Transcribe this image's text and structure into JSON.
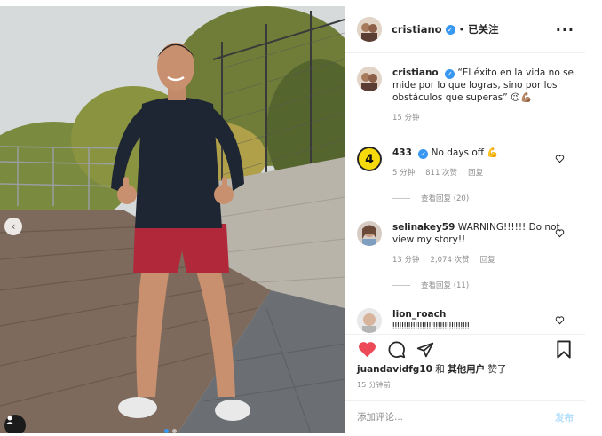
{
  "header": {
    "username": "cristiano",
    "separator": "•",
    "follow_status": "已关注",
    "more": "···"
  },
  "comments": [
    {
      "username": "cristiano",
      "text": "“El éxito en la vida no se mide por lo que logras, sino por los obstáculos que superas” 😉💪🏽",
      "time": "15 分钟",
      "verified": true
    },
    {
      "username": "433",
      "text": "No days off 💪",
      "time": "5 分钟",
      "likes": "811 次赞",
      "reply": "回复",
      "view_replies": "查看回复 (20)",
      "verified": true
    },
    {
      "username": "selinakey59",
      "text": "WARNING!!!!!! Do not view my story!!",
      "time": "13 分钟",
      "likes": "2,074 次赞",
      "reply": "回复",
      "view_replies": "查看回复 (11)"
    },
    {
      "username": "lion_roach",
      "text": "‼‼‼‼‼‼‼‼‼‼‼‼‼‼‼‼‼"
    }
  ],
  "likes": {
    "user": "juandavidfg10",
    "and": "和",
    "others": "其他用户",
    "suffix": "赞了"
  },
  "timestamp": "15 分钟前",
  "add_comment": {
    "placeholder": "添加评论...",
    "post": "发布"
  },
  "photo": {
    "nav_prev": "‹",
    "carousel_count": 2,
    "carousel_active": 0
  },
  "colors": {
    "verified": "#3897f0",
    "heart": "#ed4956",
    "post_disabled": "#b2dffc",
    "muted": "#8e8e8e"
  }
}
